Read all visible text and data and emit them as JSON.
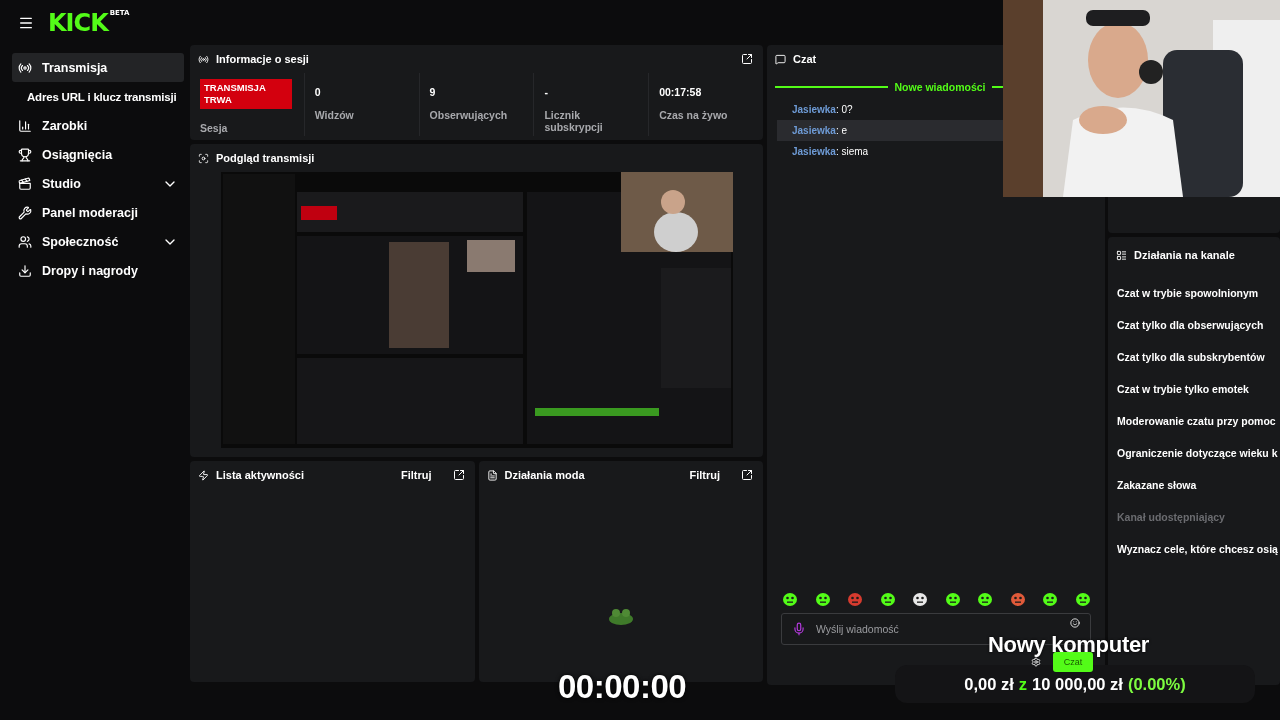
{
  "header": {
    "logo": "KICK",
    "logo_badge": "BETA"
  },
  "sidebar": {
    "items": [
      {
        "label": "Transmisja",
        "kind": "link",
        "selected": true,
        "children": [
          {
            "label": "Adres URL i klucz transmisji",
            "selected": false
          }
        ]
      },
      {
        "label": "Zarobki",
        "kind": "link",
        "selected": false
      },
      {
        "label": "Osiągnięcia",
        "kind": "link",
        "selected": false
      },
      {
        "label": "Studio",
        "kind": "group",
        "selected": false
      },
      {
        "label": "Panel moderacji",
        "kind": "link",
        "selected": false
      },
      {
        "label": "Społeczność",
        "kind": "group",
        "selected": false
      },
      {
        "label": "Dropy i nagrody",
        "kind": "link",
        "selected": false
      }
    ]
  },
  "session": {
    "title": "Informacje o sesji",
    "live": true,
    "status": "TRANSMISJA TRWA",
    "status_label": "Sesja",
    "stats": [
      {
        "value": "0",
        "label": "Widzów"
      },
      {
        "value": "9",
        "label": "Obserwujących"
      },
      {
        "value": "-",
        "label": "Licznik subskrypcji"
      },
      {
        "value": "00:17:58",
        "label": "Czas na żywo"
      }
    ]
  },
  "preview": {
    "title": "Podgląd transmisji",
    "kind": "picture"
  },
  "activity": {
    "title": "Lista aktywności",
    "filter": "Filtruj"
  },
  "mod_actions": {
    "title": "Działania moda",
    "filter": "Filtruj"
  },
  "chat": {
    "title": "Czat",
    "divider": "Nowe wiadomości",
    "messages": [
      {
        "user": "Jasiewka",
        "separator": ":",
        "text": "0?",
        "highlighted": false
      },
      {
        "user": "Jasiewka",
        "separator": ":",
        "text": "e",
        "highlighted": true
      },
      {
        "user": "Jasiewka",
        "separator": ":",
        "text": "siema",
        "highlighted": false
      }
    ],
    "placeholder": "Wyślij wiadomość"
  },
  "channel_actions": {
    "title": "Działania na kanale",
    "items": [
      {
        "label": "Czat w trybie spowolnionym",
        "disabled": false
      },
      {
        "label": "Czat tylko dla obserwujących",
        "disabled": false
      },
      {
        "label": "Czat tylko dla subskrybentów",
        "disabled": false
      },
      {
        "label": "Czat w trybie tylko emotek",
        "disabled": false
      },
      {
        "label": "Moderowanie czatu przy pomoc",
        "disabled": false
      },
      {
        "label": "Ograniczenie dotyczące wieku k",
        "disabled": false
      },
      {
        "label": "Zakazane słowa",
        "disabled": false
      },
      {
        "label": "Kanał udostępniający",
        "disabled": true
      },
      {
        "label": "Wyznacz cele, które chcesz osią",
        "disabled": false
      }
    ]
  },
  "overlay": {
    "goal_title": "Nowy komputer",
    "chat_button": "Czat",
    "goal_current": "0,00 zł",
    "goal_separator": "z",
    "goal_target": "10 000,00 zł",
    "goal_percent": "(0.00%)",
    "timer": "00:00:00"
  }
}
